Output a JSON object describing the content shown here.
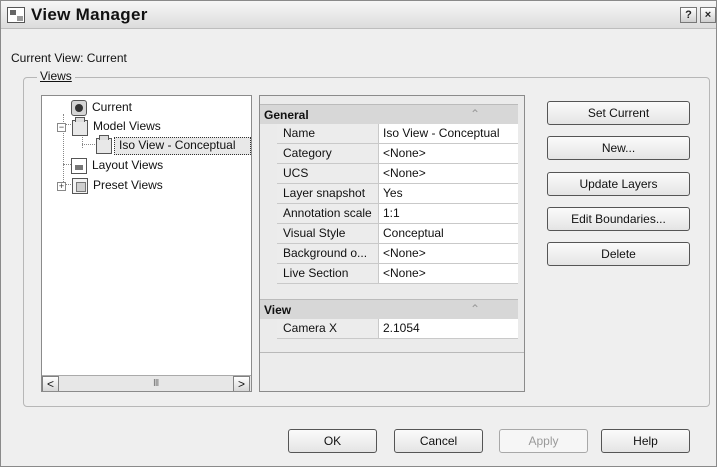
{
  "window": {
    "title": "View Manager",
    "help_glyph": "?",
    "close_glyph": "×",
    "current_view_label": "Current View: Current",
    "views_group_label": "Views"
  },
  "tree": {
    "items": [
      {
        "label": "Current",
        "icon": "camera-icon",
        "indent": 0
      },
      {
        "label": "Model Views",
        "icon": "folder-icon",
        "indent": 0,
        "expanded": true
      },
      {
        "label": "Iso View - Conceptual",
        "icon": "view-icon",
        "indent": 1,
        "selected": true
      },
      {
        "label": "Layout Views",
        "icon": "layout-icon",
        "indent": 0
      },
      {
        "label": "Preset Views",
        "icon": "preset-icon",
        "indent": 0,
        "expanded": false
      }
    ],
    "scroll": {
      "left_glyph": "<",
      "right_glyph": ">",
      "thumb_marks": "III"
    }
  },
  "properties": {
    "sections": [
      {
        "title": "General",
        "rows": [
          {
            "name": "Name",
            "value": "Iso View - Conceptual"
          },
          {
            "name": "Category",
            "value": "<None>"
          },
          {
            "name": "UCS",
            "value": "<None>"
          },
          {
            "name": "Layer snapshot",
            "value": "Yes"
          },
          {
            "name": "Annotation scale",
            "value": "1:1"
          },
          {
            "name": "Visual Style",
            "value": "Conceptual"
          },
          {
            "name": "Background o...",
            "value": "<None>"
          },
          {
            "name": "Live Section",
            "value": "<None>"
          }
        ]
      },
      {
        "title": "View",
        "rows": [
          {
            "name": "Camera X",
            "value": "2.1054"
          }
        ]
      }
    ],
    "collapse_glyph": "⌃",
    "scroll_up_glyph": "▲",
    "scroll_down_glyph": "▼"
  },
  "buttons": {
    "set_current": "Set Current",
    "new": "New...",
    "update_layers": "Update Layers",
    "edit_boundaries": "Edit Boundaries...",
    "delete": "Delete",
    "ok": "OK",
    "cancel": "Cancel",
    "apply": "Apply",
    "help": "Help"
  },
  "colors": {
    "dialog_background": "#efefef",
    "selection_background": "#e8e8e8",
    "disabled_text": "#9a9a9a"
  }
}
